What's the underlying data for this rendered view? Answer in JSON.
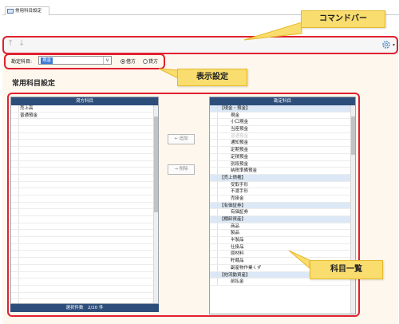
{
  "window": {
    "tab_label": "常用科目設定"
  },
  "toolbar": {
    "up_arrow": "↑",
    "down_arrow": "↓",
    "settings_icon": "gear-icon",
    "dropdown_caret": "▾"
  },
  "settings": {
    "kamoku_label": "勘定科目:",
    "kamoku_value": "現金",
    "radio_debit": "借方",
    "radio_credit": "貸方",
    "selected": "借方"
  },
  "page_title": "常用科目設定",
  "left_panel": {
    "header": "貸方科目",
    "items": [
      "売上高",
      "普通預金"
    ],
    "footer": "選択件数　2/20 件"
  },
  "buttons": {
    "add_label": "追加",
    "remove_label": "削除"
  },
  "right_panel": {
    "header": "勘定科目",
    "rows": [
      {
        "type": "group",
        "label": "【現金・預金】"
      },
      {
        "type": "item",
        "label": "現金"
      },
      {
        "type": "item",
        "label": "小口現金"
      },
      {
        "type": "item",
        "label": "当座預金"
      },
      {
        "type": "item",
        "label": "普通預金",
        "dimmed": true
      },
      {
        "type": "item",
        "label": "通知預金"
      },
      {
        "type": "item",
        "label": "定期預金"
      },
      {
        "type": "item",
        "label": "定積預金"
      },
      {
        "type": "item",
        "label": "別段預金"
      },
      {
        "type": "item",
        "label": "納税準備預金"
      },
      {
        "type": "group",
        "label": "【売上債権】"
      },
      {
        "type": "item",
        "label": "受取手形"
      },
      {
        "type": "item",
        "label": "不渡手形"
      },
      {
        "type": "item",
        "label": "売掛金"
      },
      {
        "type": "group",
        "label": "【有価証券】"
      },
      {
        "type": "item",
        "label": "有価証券"
      },
      {
        "type": "group",
        "label": "【棚卸資産】"
      },
      {
        "type": "item",
        "label": "商品"
      },
      {
        "type": "item",
        "label": "製品"
      },
      {
        "type": "item",
        "label": "半製品"
      },
      {
        "type": "item",
        "label": "仕掛品"
      },
      {
        "type": "item",
        "label": "原材料"
      },
      {
        "type": "item",
        "label": "貯蔵品"
      },
      {
        "type": "item",
        "label": "副産物作業くず"
      },
      {
        "type": "group",
        "label": "【他流動資産】"
      },
      {
        "type": "item",
        "label": "前払金"
      }
    ]
  },
  "callouts": {
    "command_bar": "コマンドバー",
    "display_settings": "表示設定",
    "account_list": "科目一覧"
  },
  "colors": {
    "annotation_red": "#e0202f",
    "callout_yellow": "#f9dd6e",
    "header_navy": "#2d4e7a",
    "group_row": "#dce8f5",
    "select_highlight": "#3b79d8"
  }
}
